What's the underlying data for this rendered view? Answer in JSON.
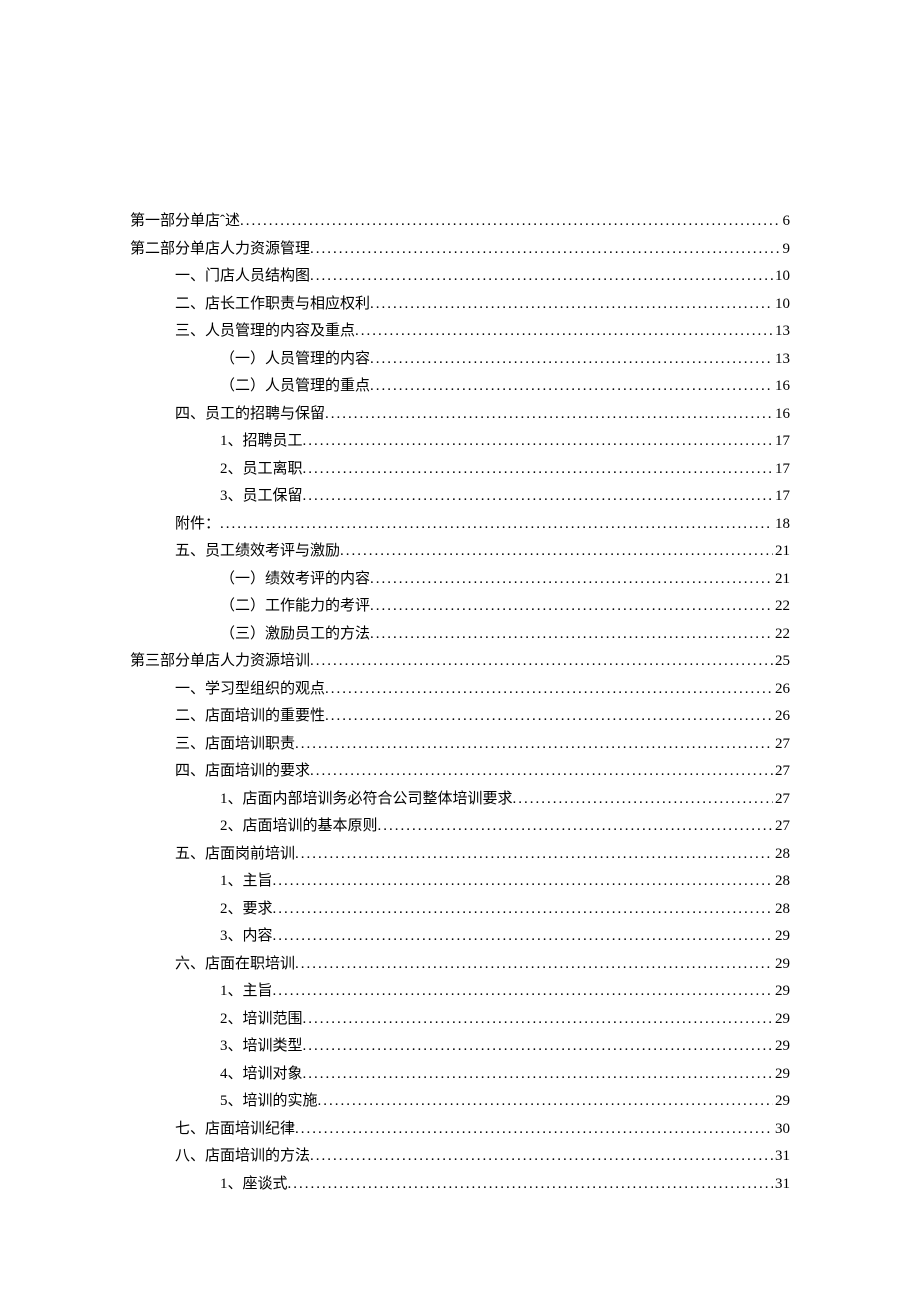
{
  "toc": [
    {
      "level": 0,
      "label": "第一部分单店ˆ述",
      "page": "6"
    },
    {
      "level": 0,
      "label": "第二部分单店人力资源管理",
      "page": "9"
    },
    {
      "level": 1,
      "label": "一、门店人员结构图",
      "page": "10"
    },
    {
      "level": 1,
      "label": "二、店长工作职责与相应权利",
      "page": "10"
    },
    {
      "level": 1,
      "label": "三、人员管理的内容及重点",
      "page": "13"
    },
    {
      "level": 2,
      "label": "（一）人员管理的内容 ",
      "page": "13"
    },
    {
      "level": 2,
      "label": "（二）人员管理的重点 ",
      "page": "16"
    },
    {
      "level": 1,
      "label": "四、员工的招聘与保留",
      "page": "16"
    },
    {
      "level": 2,
      "label": "1、招聘员工",
      "page": "17"
    },
    {
      "level": 2,
      "label": "2、员工离职",
      "page": "17"
    },
    {
      "level": 2,
      "label": "3、员工保留",
      "page": "17"
    },
    {
      "level": 1,
      "label": "附件： ",
      "page": "18"
    },
    {
      "level": 1,
      "label": "五、员工绩效考评与激励",
      "page": "21"
    },
    {
      "level": 2,
      "label": "（一）绩效考评的内容 ",
      "page": "21"
    },
    {
      "level": 2,
      "label": "（二）工作能力的考评 ",
      "page": "22"
    },
    {
      "level": 2,
      "label": "（三）激励员工的方法 ",
      "page": "22"
    },
    {
      "level": 0,
      "label": "第三部分单店人力资源培训",
      "page": "25"
    },
    {
      "level": 1,
      "label": "一、学习型组织的观点",
      "page": "26"
    },
    {
      "level": 1,
      "label": "二、店面培训的重要性",
      "page": "26"
    },
    {
      "level": 1,
      "label": "三、店面培训职责",
      "page": "27"
    },
    {
      "level": 1,
      "label": "四、店面培训的要求",
      "page": "27"
    },
    {
      "level": 2,
      "label": "1、店面内部培训务必符合公司整体培训要求",
      "page": "27"
    },
    {
      "level": 2,
      "label": "2、店面培训的基本原则",
      "page": "27"
    },
    {
      "level": 1,
      "label": "五、店面岗前培训",
      "page": "28"
    },
    {
      "level": 2,
      "label": "1、主旨",
      "page": "28"
    },
    {
      "level": 2,
      "label": "2、要求",
      "page": "28"
    },
    {
      "level": 2,
      "label": "3、内容",
      "page": "29"
    },
    {
      "level": 1,
      "label": "六、店面在职培训",
      "page": "29"
    },
    {
      "level": 2,
      "label": "1、主旨",
      "page": "29"
    },
    {
      "level": 2,
      "label": "2、培训范围",
      "page": "29"
    },
    {
      "level": 2,
      "label": "3、培训类型",
      "page": "29"
    },
    {
      "level": 2,
      "label": "4、培训对象",
      "page": "29"
    },
    {
      "level": 2,
      "label": "5、培训的实施",
      "page": "29"
    },
    {
      "level": 1,
      "label": "七、店面培训纪律",
      "page": "30"
    },
    {
      "level": 1,
      "label": "八、店面培训的方法",
      "page": "31"
    },
    {
      "level": 2,
      "label": "1、座谈式",
      "page": "31"
    }
  ]
}
